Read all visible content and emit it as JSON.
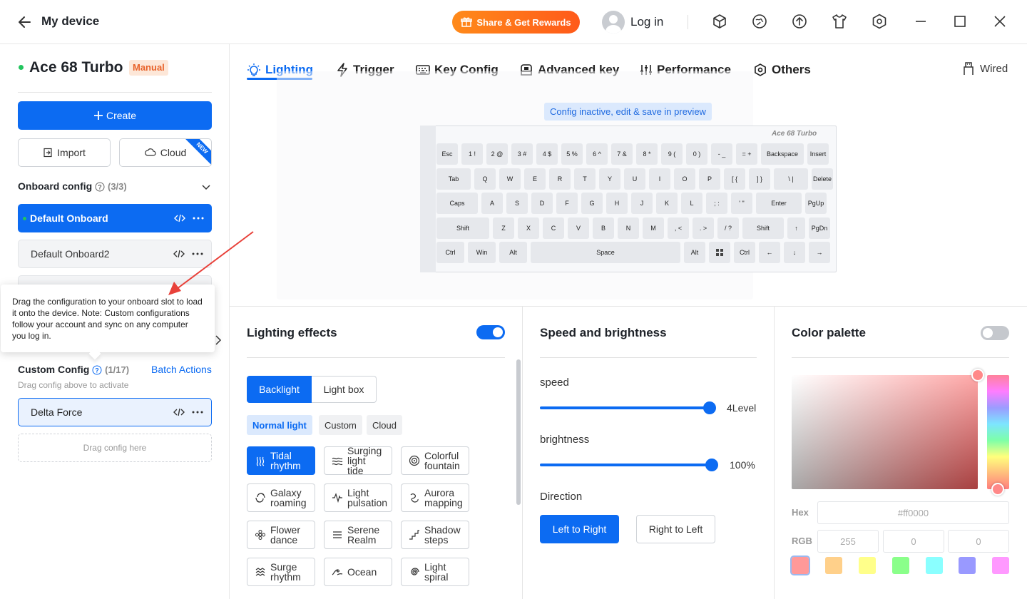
{
  "titlebar": {
    "title": "My device",
    "share_label": "Share & Get Rewards",
    "login_label": "Log in",
    "icons": [
      "cube-icon",
      "globe-sync-icon",
      "upload-icon",
      "tshirt-icon",
      "hex-settings-icon",
      "minimize-icon",
      "maximize-icon",
      "close-icon"
    ]
  },
  "device": {
    "name": "Ace 68 Turbo",
    "mode_badge": "Manual",
    "status_color": "#22c55e"
  },
  "sidebar": {
    "create_label": "Create",
    "import_label": "Import",
    "cloud_label": "Cloud",
    "new_badge": "NEW",
    "onboard": {
      "title": "Onboard config",
      "count": "(3/3)",
      "items": [
        {
          "label": "Default Onboard"
        },
        {
          "label": "Default Onboard2"
        }
      ]
    },
    "tooltip": "Drag the configuration to your onboard slot to load it onto the device. Note: Custom configurations follow your account and sync on any computer you log in.",
    "custom": {
      "title": "Custom Config",
      "count": "(1/17)",
      "batch_label": "Batch Actions",
      "hint": "Drag config above to activate",
      "items": [
        {
          "label": "Delta Force"
        }
      ],
      "drop_label": "Drag config here"
    }
  },
  "tabs": [
    {
      "label": "Lighting",
      "icon": "bulb-icon"
    },
    {
      "label": "Trigger",
      "icon": "bolt-icon"
    },
    {
      "label": "Key Config",
      "icon": "keyboard-icon"
    },
    {
      "label": "Advanced key",
      "icon": "advanced-key-icon"
    },
    {
      "label": "Performance",
      "icon": "sliders-icon"
    },
    {
      "label": "Others",
      "icon": "hex-settings-icon"
    }
  ],
  "connection": "Wired",
  "preview": {
    "banner": "Config inactive, edit & save in preview",
    "brand": "Ace 68 Turbo",
    "rows": [
      [
        "Esc",
        "1 !",
        "2 @",
        "3 #",
        "4 $",
        "5 %",
        "6 ^",
        "7 &",
        "8 *",
        "9 (",
        "0 )",
        "- _",
        "= +",
        "Backspace",
        "Insert"
      ],
      [
        "Tab",
        "Q",
        "W",
        "E",
        "R",
        "T",
        "Y",
        "U",
        "I",
        "O",
        "P",
        "[ {",
        "] }",
        "\\ |",
        "Delete"
      ],
      [
        "Caps",
        "A",
        "S",
        "D",
        "F",
        "G",
        "H",
        "J",
        "K",
        "L",
        "; :",
        "' \"",
        "Enter",
        "PgUp"
      ],
      [
        "Shift",
        "Z",
        "X",
        "C",
        "V",
        "B",
        "N",
        "M",
        ", <",
        ". >",
        "/ ?",
        "Shift",
        "↑",
        "PgDn"
      ],
      [
        "Ctrl",
        "Win",
        "Alt",
        "Space",
        "Alt",
        "",
        "Ctrl",
        "←",
        "↓",
        "→"
      ]
    ]
  },
  "lighting_effects": {
    "title": "Lighting effects",
    "enabled": true,
    "modes": [
      "Backlight",
      "Light box"
    ],
    "categories": [
      "Normal light",
      "Custom",
      "Cloud"
    ],
    "effects": [
      {
        "label": "Tidal rhythm",
        "icon": "waves-icon"
      },
      {
        "label": "Surging light tide",
        "icon": "tide-icon"
      },
      {
        "label": "Colorful fountain",
        "icon": "fountain-icon"
      },
      {
        "label": "Galaxy roaming",
        "icon": "galaxy-icon"
      },
      {
        "label": "Light pulsation",
        "icon": "pulse-icon"
      },
      {
        "label": "Aurora mapping",
        "icon": "aurora-icon"
      },
      {
        "label": "Flower dance",
        "icon": "flower-icon"
      },
      {
        "label": "Serene Realm",
        "icon": "lines-icon"
      },
      {
        "label": "Shadow steps",
        "icon": "steps-icon"
      },
      {
        "label": "Surge rhythm",
        "icon": "surge-icon"
      },
      {
        "label": "Ocean",
        "icon": "ocean-icon"
      },
      {
        "label": "Light spiral",
        "icon": "spiral-icon"
      }
    ]
  },
  "speed_brightness": {
    "title": "Speed and brightness",
    "speed_label": "speed",
    "speed_value": "4Level",
    "speed_fraction": 1.0,
    "brightness_label": "brightness",
    "brightness_value": "100%",
    "brightness_fraction": 1.0,
    "direction_label": "Direction",
    "directions": [
      "Left to Right",
      "Right to Left"
    ]
  },
  "palette": {
    "title": "Color palette",
    "enabled": false,
    "hex_label": "Hex",
    "hex_value": "#ff0000",
    "rgb_label": "RGB",
    "rgb": [
      "255",
      "0",
      "0"
    ],
    "swatches": [
      "#ff9999",
      "#ffd08a",
      "#ffff8a",
      "#8aff8a",
      "#8affff",
      "#9999ff",
      "#ff99ff"
    ]
  }
}
